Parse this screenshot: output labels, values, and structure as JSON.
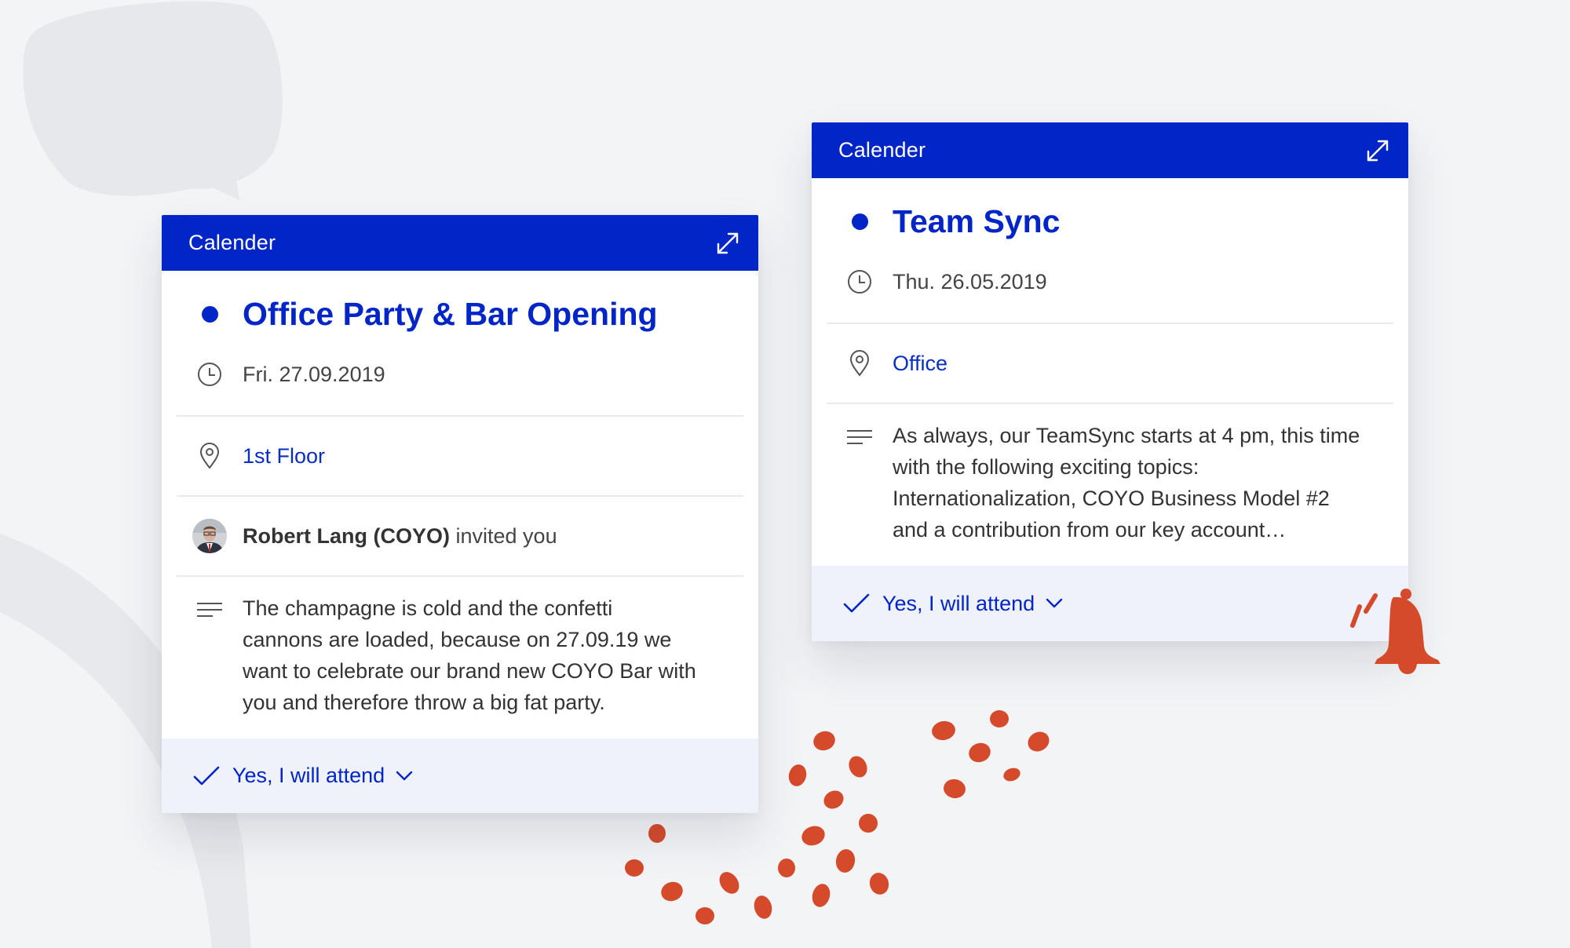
{
  "cards": [
    {
      "header_title": "Calender",
      "event_title": "Office Party & Bar Opening",
      "date": "Fri. 27.09.2019",
      "location": "1st Floor",
      "inviter_name": "Robert Lang (COYO)",
      "invited_text": " invited you",
      "description": "The champagne is cold and the confetti cannons are loaded, because on 27.09.19 we want to celebrate our brand new COYO Bar with you and therefore throw a big fat party.",
      "attend_label": "Yes, I will attend"
    },
    {
      "header_title": "Calender",
      "event_title": "Team Sync",
      "date": "Thu. 26.05.2019",
      "location": "Office",
      "description": "As always, our TeamSync starts at 4 pm, this time with the following exciting topics: Internationalization, COYO Business Model #2 and a contribution from our key account…",
      "attend_label": "Yes, I will attend"
    }
  ],
  "icons": [
    "expand-icon",
    "clock-icon",
    "location-pin-icon",
    "description-lines-icon",
    "checkmark-icon",
    "chevron-down-icon",
    "bell-icon"
  ],
  "colors": {
    "brand_blue": "#0225c8",
    "background": "#f3f4f6",
    "accent_orange": "#d44a2b",
    "attend_bar": "#eff2fa",
    "divider": "#e9eaee"
  }
}
